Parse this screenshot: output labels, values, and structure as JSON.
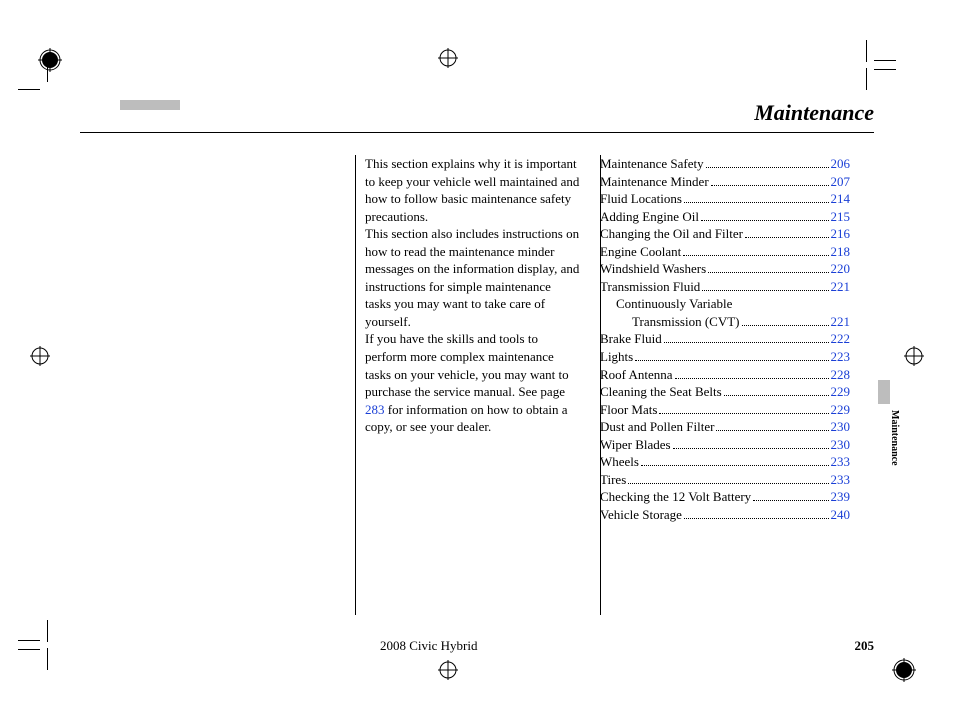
{
  "header": {
    "title": "Maintenance"
  },
  "intro": {
    "p1": "This section explains why it is important to keep your vehicle well maintained and how to follow basic maintenance safety precautions.",
    "p2": "This section also includes instructions on how to read the maintenance minder messages on the information display, and instructions for simple maintenance tasks you may want to take care of yourself.",
    "p3_a": "If you have the skills and tools to perform more complex maintenance tasks on your vehicle, you may want to purchase the service manual. See page ",
    "p3_link": "283",
    "p3_b": " for information on how to obtain a copy, or see your dealer."
  },
  "toc": [
    {
      "label": "Maintenance Safety",
      "page": "206",
      "indent": 0
    },
    {
      "label": "Maintenance Minder",
      "page": "207",
      "indent": 0
    },
    {
      "label": "Fluid Locations",
      "page": "214",
      "indent": 0
    },
    {
      "label": "Adding Engine Oil",
      "page": "215",
      "indent": 0
    },
    {
      "label": "Changing the Oil and Filter",
      "page": "216",
      "indent": 0
    },
    {
      "label": "Engine Coolant",
      "page": "218",
      "indent": 0
    },
    {
      "label": "Windshield Washers",
      "page": "220",
      "indent": 0
    },
    {
      "label": "Transmission Fluid",
      "page": "221",
      "indent": 0
    },
    {
      "label": "Continuously Variable",
      "page": "",
      "indent": 1,
      "nodots": true
    },
    {
      "label": "Transmission (CVT)",
      "page": "221",
      "indent": 2
    },
    {
      "label": "Brake Fluid",
      "page": "222",
      "indent": 0
    },
    {
      "label": "Lights",
      "page": "223",
      "indent": 0
    },
    {
      "label": "Roof Antenna",
      "page": "228",
      "indent": 0
    },
    {
      "label": "Cleaning the Seat Belts",
      "page": "229",
      "indent": 0
    },
    {
      "label": "Floor Mats",
      "page": "229",
      "indent": 0
    },
    {
      "label": "Dust and Pollen Filter",
      "page": "230",
      "indent": 0
    },
    {
      "label": "Wiper Blades",
      "page": "230",
      "indent": 0
    },
    {
      "label": "Wheels",
      "page": "233",
      "indent": 0
    },
    {
      "label": "Tires",
      "page": "233",
      "indent": 0
    },
    {
      "label": "Checking the 12 Volt Battery",
      "page": "239",
      "indent": 0
    },
    {
      "label": "Vehicle Storage",
      "page": "240",
      "indent": 0
    }
  ],
  "footer": {
    "model": "2008  Civic  Hybrid",
    "page_number": "205"
  },
  "side": {
    "tab_label": "Maintenance"
  }
}
